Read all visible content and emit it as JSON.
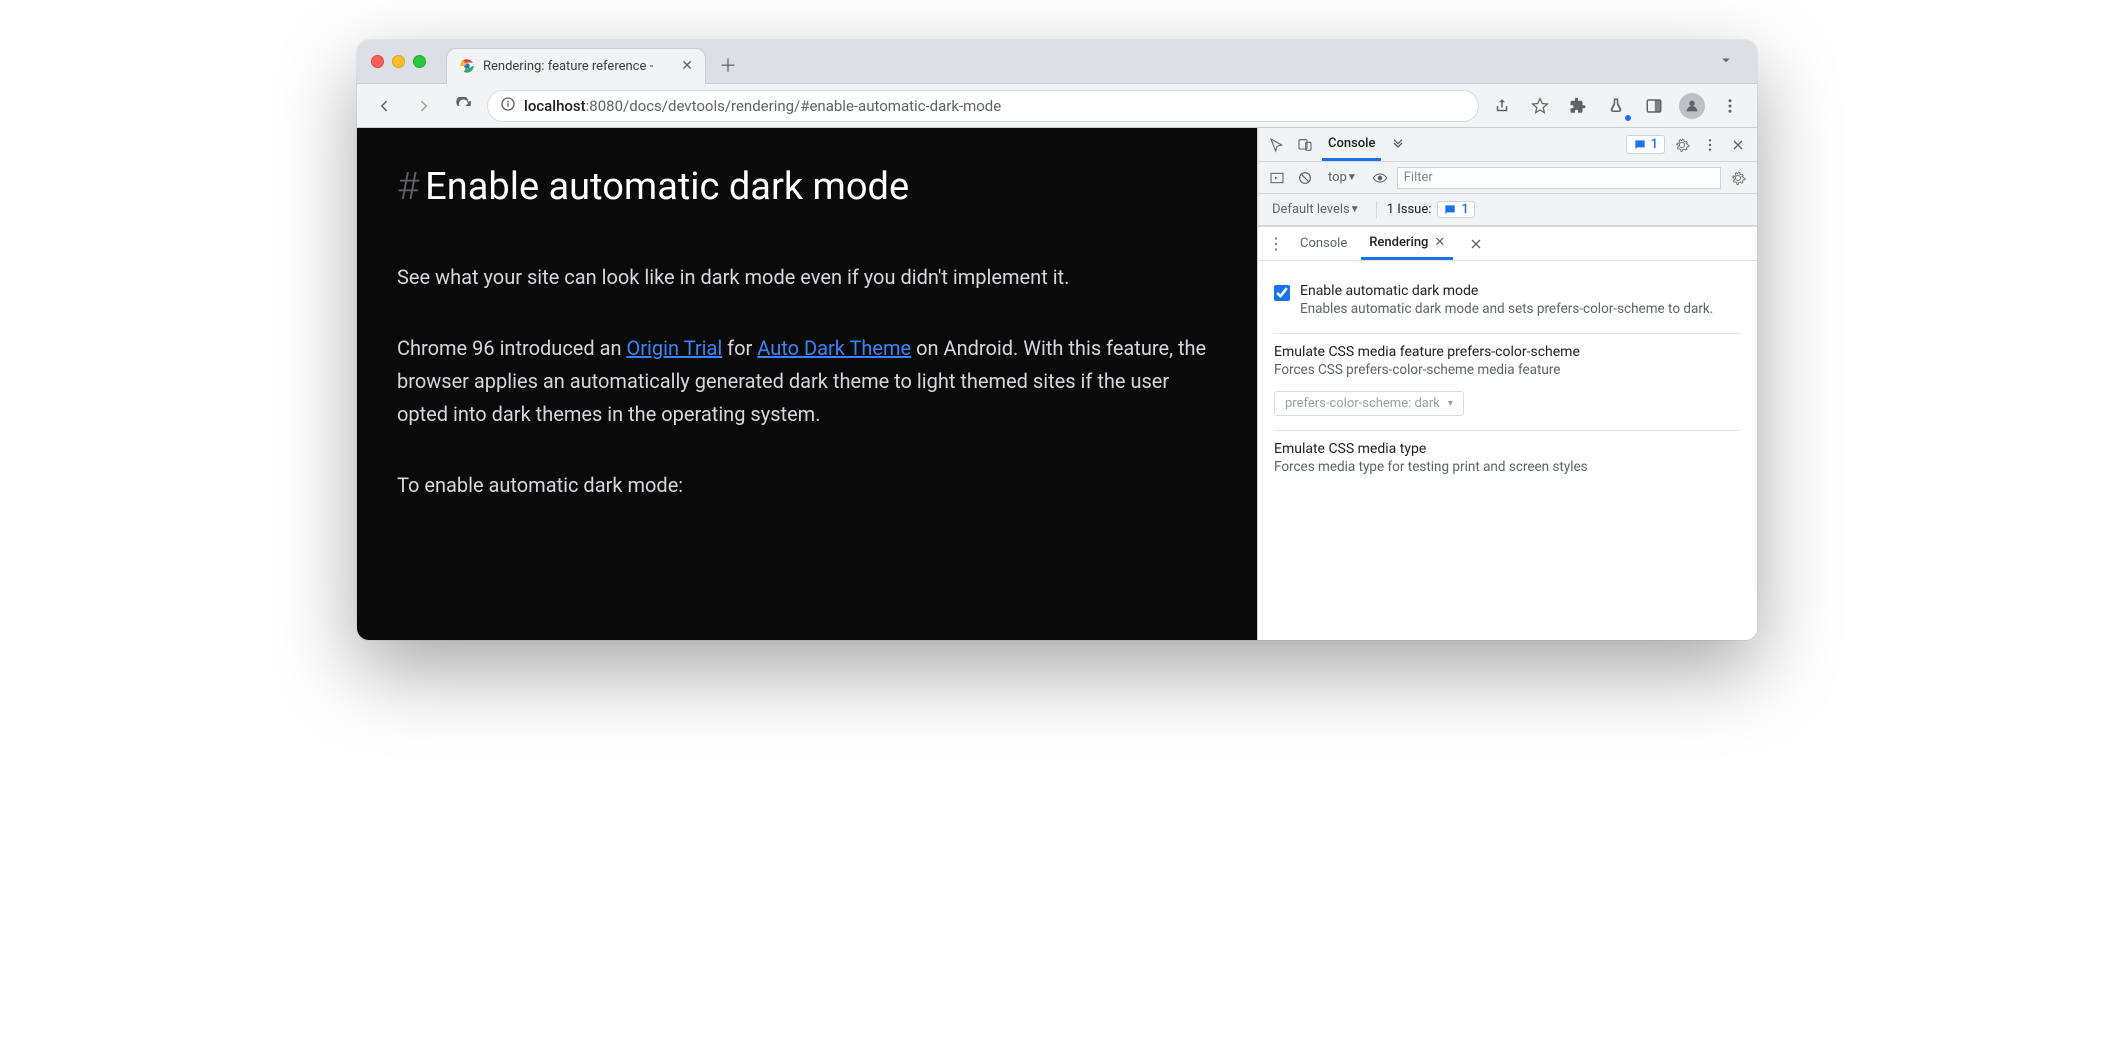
{
  "browser": {
    "tab_title": "Rendering: feature reference -",
    "url_host": "localhost",
    "url_port": ":8080",
    "url_path": "/docs/devtools/rendering/#enable-automatic-dark-mode"
  },
  "page": {
    "hash": "#",
    "h1": "Enable automatic dark mode",
    "p1": "See what your site can look like in dark mode even if you didn't implement it.",
    "p2_a": "Chrome 96 introduced an ",
    "p2_link1": "Origin Trial",
    "p2_b": " for ",
    "p2_link2": "Auto Dark Theme",
    "p2_c": " on Android. With this feature, the browser applies an automatically generated dark theme to light themed sites if the user opted into dark themes in the operating system.",
    "p3": "To enable automatic dark mode:"
  },
  "devtools": {
    "main_tab": "Console",
    "issues_count": "1",
    "context": "top",
    "filter_placeholder": "Filter",
    "levels": "Default levels",
    "issues_label": "1 Issue:",
    "issues_badge": "1",
    "drawer_tab_console": "Console",
    "drawer_tab_rendering": "Rendering",
    "settings": {
      "s1_title": "Enable automatic dark mode",
      "s1_desc": "Enables automatic dark mode and sets prefers-color-scheme to dark.",
      "s1_checked": true,
      "s2_title": "Emulate CSS media feature prefers-color-scheme",
      "s2_desc": "Forces CSS prefers-color-scheme media feature",
      "s2_select": "prefers-color-scheme: dark",
      "s3_title": "Emulate CSS media type",
      "s3_desc": "Forces media type for testing print and screen styles"
    }
  }
}
